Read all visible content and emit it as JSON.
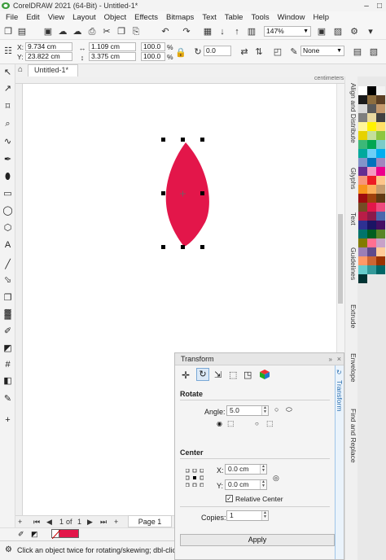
{
  "window": {
    "title": "CorelDRAW 2021 (64-Bit) - Untitled-1*",
    "min": "–",
    "max": "□"
  },
  "menu": [
    "File",
    "Edit",
    "View",
    "Layout",
    "Object",
    "Effects",
    "Bitmaps",
    "Text",
    "Table",
    "Tools",
    "Window",
    "Help"
  ],
  "toolbar": {
    "zoom": "147%"
  },
  "property_bar": {
    "x": "9.734 cm",
    "y": "23.822 cm",
    "width": "1.109 cm",
    "height": "3.375 cm",
    "scale_w": "100.0",
    "scale_h": "100.0",
    "pct": "%",
    "rotation": "0.0",
    "outline": "None"
  },
  "document": {
    "tab": "Untitled-1*",
    "ruler_unit": "centimeters",
    "page_current": "1",
    "page_of": "of",
    "page_total": "1",
    "page_tab": "Page 1"
  },
  "dockers": {
    "tabs": [
      "Align and Distribute",
      "Glyphs",
      "Text",
      "Guidelines",
      "Extrude",
      "Envelope",
      "Find and Replace"
    ]
  },
  "transform": {
    "title": "Transform",
    "side_label": "Transform",
    "rotate_label": "Rotate",
    "angle_label": "Angle:",
    "angle_value": "5.0",
    "center_label": "Center",
    "x_label": "X:",
    "x_value": "0.0 cm",
    "y_label": "Y:",
    "y_value": "0.0 cm",
    "relative_center": "Relative Center",
    "copies_label": "Copies:",
    "copies_value": "1",
    "apply": "Apply"
  },
  "status": {
    "text": "Click an object twice for rotating/skewing; dbl-clicking"
  },
  "colors": {
    "shape_fill": "#e3164a"
  },
  "palette": [
    "#ffffff",
    "#000000",
    "#f2f2f2",
    "#1a1a1a",
    "#8c6d3f",
    "#5b3f24",
    "#d9d9d9",
    "#595959",
    "#c59a6d",
    "#7f7f7f",
    "#e9d9a0",
    "#404040",
    "#fff799",
    "#fff200",
    "#ffe066",
    "#e6d200",
    "#c4df9b",
    "#8dc63f",
    "#3cb878",
    "#00a651",
    "#7accc8",
    "#00a99d",
    "#6dcff6",
    "#00aeef",
    "#8393ca",
    "#0072bc",
    "#a186be",
    "#662d91",
    "#f49ac1",
    "#ec008c",
    "#f7977a",
    "#ed1c24",
    "#fdc68a",
    "#f7941d",
    "#fbaf5d",
    "#c69c6d",
    "#9e0b0f",
    "#a0410d",
    "#603913",
    "#754c24",
    "#e3164a",
    "#ee4a7e",
    "#b91d47",
    "#8b1a4a",
    "#4a66ac",
    "#2e3192",
    "#1b1464",
    "#440e62",
    "#00746b",
    "#005e20",
    "#598527",
    "#827b00",
    "#ff6f91",
    "#c8a2c8",
    "#9b7fb6",
    "#5e4b8b",
    "#ffcc99",
    "#ff9966",
    "#cc6633",
    "#993300",
    "#66cccc",
    "#339999",
    "#006666",
    "#003333"
  ]
}
